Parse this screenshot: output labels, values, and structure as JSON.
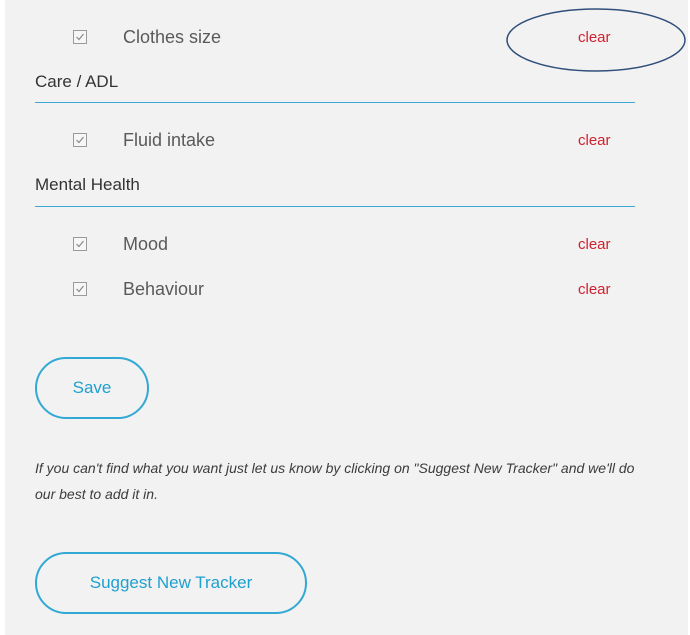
{
  "sections": [
    {
      "title": "",
      "items": [
        {
          "label": "Clothes size",
          "checked": true,
          "clear_label": "clear"
        }
      ]
    },
    {
      "title": "Care / ADL",
      "items": [
        {
          "label": "Fluid intake",
          "checked": true,
          "clear_label": "clear"
        }
      ]
    },
    {
      "title": "Mental Health",
      "items": [
        {
          "label": "Mood",
          "checked": true,
          "clear_label": "clear"
        },
        {
          "label": "Behaviour",
          "checked": true,
          "clear_label": "clear"
        }
      ]
    }
  ],
  "save_label": "Save",
  "help_text": "If you can't find what you want just let us know by clicking on \"Suggest New Tracker\" and we'll do our best to add it in.",
  "suggest_label": "Suggest New Tracker",
  "colors": {
    "accent": "#32a8d4",
    "clear": "#d22030",
    "annotation": "#2f4f7a",
    "panel_bg": "#f2f2f2"
  }
}
